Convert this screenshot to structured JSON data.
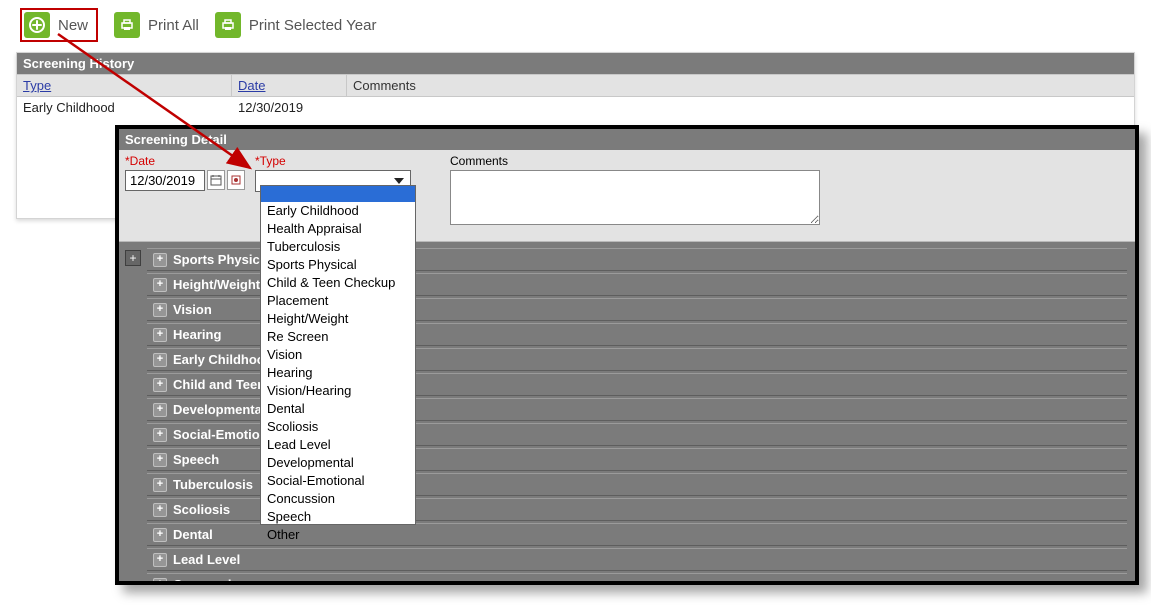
{
  "toolbar": {
    "new_label": "New",
    "print_all_label": "Print All",
    "print_selected_label": "Print Selected Year"
  },
  "history": {
    "title": "Screening History",
    "headers": {
      "type": "Type",
      "date": "Date",
      "comments": "Comments"
    },
    "rows": [
      {
        "type": "Early Childhood",
        "date": "12/30/2019",
        "comments": ""
      }
    ]
  },
  "detail": {
    "title": "Screening Detail",
    "labels": {
      "date": "*Date",
      "type": "*Type",
      "comments": "Comments"
    },
    "date_value": "12/30/2019",
    "type_value": "",
    "comments_value": "",
    "type_options": [
      "",
      "Early Childhood",
      "Health Appraisal",
      "Tuberculosis",
      "Sports Physical",
      "Child & Teen Checkup",
      "Placement",
      "Height/Weight",
      "Re Screen",
      "Vision",
      "Hearing",
      "Vision/Hearing",
      "Dental",
      "Scoliosis",
      "Lead Level",
      "Developmental",
      "Social-Emotional",
      "Concussion",
      "Speech",
      "Other"
    ],
    "sections": [
      "Sports Physical",
      "Height/Weight",
      "Vision",
      "Hearing",
      "Early Childhood",
      "Child and Teen",
      "Developmental",
      "Social-Emotional",
      "Speech",
      "Tuberculosis",
      "Scoliosis",
      "Dental",
      "Lead Level",
      "Concussion"
    ]
  }
}
